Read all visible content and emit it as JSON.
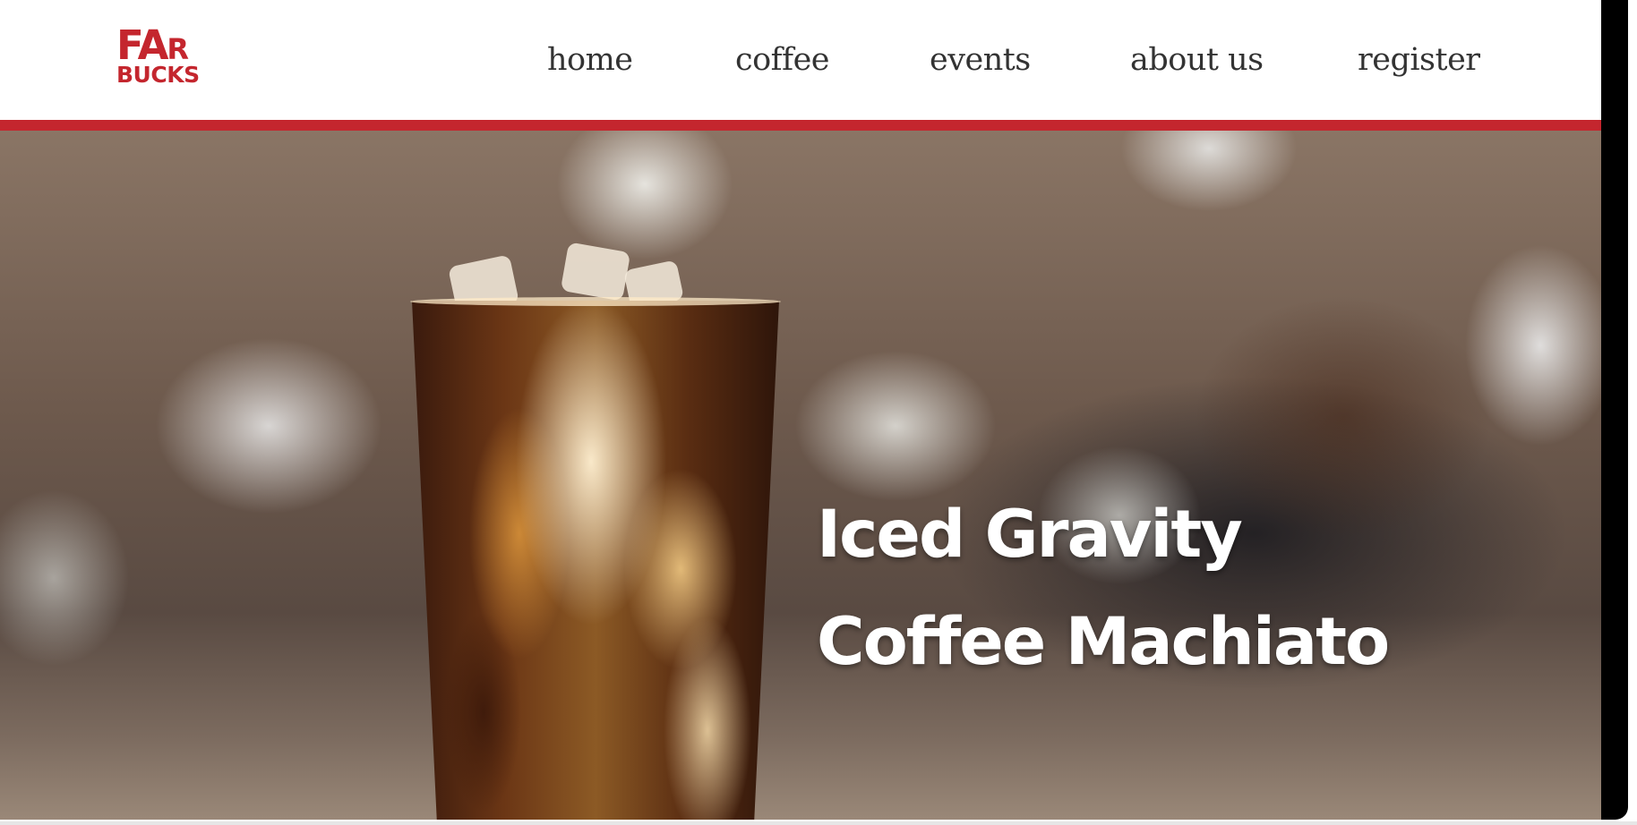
{
  "brand": {
    "logo_line1": "FAR",
    "logo_line2": "BUCKS",
    "accent_color": "#c4262e"
  },
  "nav": {
    "items": [
      {
        "label": "home"
      },
      {
        "label": "coffee"
      },
      {
        "label": "events"
      },
      {
        "label": "about us"
      },
      {
        "label": "register"
      }
    ]
  },
  "hero": {
    "title_line1": "Iced Gravity",
    "title_line2": "Coffee Machiato",
    "image": "iced-coffee-glass"
  }
}
